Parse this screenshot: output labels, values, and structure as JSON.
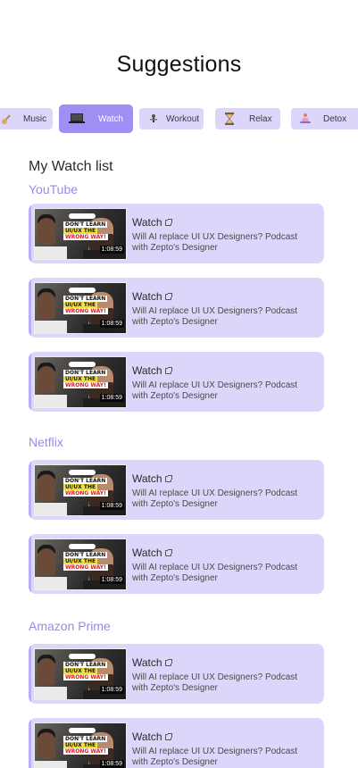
{
  "page": {
    "title": "Suggestions"
  },
  "categories": [
    {
      "label": "Music",
      "icon": "guitar-icon",
      "active": false
    },
    {
      "label": "Watch",
      "icon": "laptop-icon",
      "active": true
    },
    {
      "label": "Workout",
      "icon": "dumbbell-icon",
      "active": false
    },
    {
      "label": "Relax",
      "icon": "hourglass-icon",
      "active": false
    },
    {
      "label": "Detox",
      "icon": "meditation-icon",
      "active": false
    }
  ],
  "watchlist": {
    "heading": "My Watch list",
    "sections": [
      {
        "name": "YouTube",
        "items": [
          {
            "title": "Watch",
            "description": "Will AI replace UI UX Designers? Podcast with Zepto's Designer",
            "thumb": {
              "line1": "DON'T LEARN",
              "line2": "UI/UX THE",
              "line3": "WRONG WAY!",
              "duration": "1:08:59"
            }
          },
          {
            "title": "Watch",
            "description": "Will AI replace UI UX Designers? Podcast with Zepto's Designer",
            "thumb": {
              "line1": "DON'T LEARN",
              "line2": "UI/UX THE",
              "line3": "WRONG WAY!",
              "duration": "1:08:59"
            }
          },
          {
            "title": "Watch",
            "description": "Will AI replace UI UX Designers? Podcast with Zepto's Designer",
            "thumb": {
              "line1": "DON'T LEARN",
              "line2": "UI/UX THE",
              "line3": "WRONG WAY!",
              "duration": "1:08:59"
            }
          }
        ]
      },
      {
        "name": "Netflix",
        "items": [
          {
            "title": "Watch",
            "description": "Will AI replace UI UX Designers? Podcast with Zepto's Designer",
            "thumb": {
              "line1": "DON'T LEARN",
              "line2": "UI/UX THE",
              "line3": "WRONG WAY!",
              "duration": "1:08:59"
            }
          },
          {
            "title": "Watch",
            "description": "Will AI replace UI UX Designers? Podcast with Zepto's Designer",
            "thumb": {
              "line1": "DON'T LEARN",
              "line2": "UI/UX THE",
              "line3": "WRONG WAY!",
              "duration": "1:08:59"
            }
          }
        ]
      },
      {
        "name": "Amazon Prime",
        "items": [
          {
            "title": "Watch",
            "description": "Will AI replace UI UX Designers? Podcast with Zepto's Designer",
            "thumb": {
              "line1": "DON'T LEARN",
              "line2": "UI/UX THE",
              "line3": "WRONG WAY!",
              "duration": "1:08:59"
            }
          },
          {
            "title": "Watch",
            "description": "Will AI replace UI UX Designers? Podcast with Zepto's Designer",
            "thumb": {
              "line1": "DON'T LEARN",
              "line2": "UI/UX THE",
              "line3": "WRONG WAY!",
              "duration": "1:08:59"
            }
          }
        ]
      }
    ]
  },
  "colors": {
    "accent": "#9f8ff5",
    "card": "#ddd6fb",
    "section": "#9a87ee"
  }
}
